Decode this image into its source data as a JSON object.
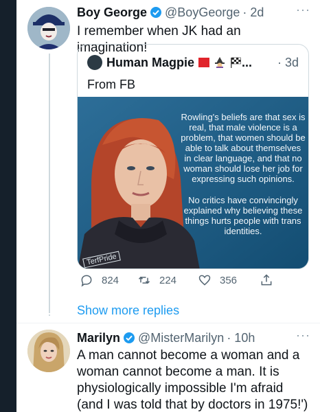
{
  "tweet1": {
    "name": "Boy George",
    "handle": "@BoyGeorge",
    "time": "· 2d",
    "text": "I remember when JK had an imagination!",
    "more": "···"
  },
  "quote": {
    "name": "Human Magpie",
    "name_suffix": "...",
    "time": "· 3d",
    "text": "From FB",
    "media_paragraph1": "Rowling's beliefs are that sex is real, that male violence is a problem, that women should be able to talk about themselves in clear language, and that no woman should lose her job for expressing such opinions.",
    "media_paragraph2": "No critics have convincingly explained why believing these things hurts people with trans identities.",
    "watermark": "TerfPride"
  },
  "actions": {
    "reply_count": "824",
    "retweet_count": "224",
    "like_count": "356"
  },
  "show_more": "Show more replies",
  "tweet2": {
    "name": "Marilyn",
    "handle": "@MisterMarilyn",
    "time": "· 10h",
    "text": "A man cannot become a woman and a woman cannot become a man. It is physiologically impossible I'm afraid (and I was told that by doctors in 1975!')",
    "more": "···"
  },
  "colors": {
    "accent": "#1d9bf0",
    "text": "#0f1419",
    "muted": "#536471",
    "border": "#cfd9de",
    "left_bar": "#15202b",
    "media_bg": "#1b5e86"
  },
  "icons": [
    "verified-badge-icon",
    "more-dots-icon",
    "reply-icon",
    "retweet-icon",
    "like-icon",
    "share-icon"
  ]
}
